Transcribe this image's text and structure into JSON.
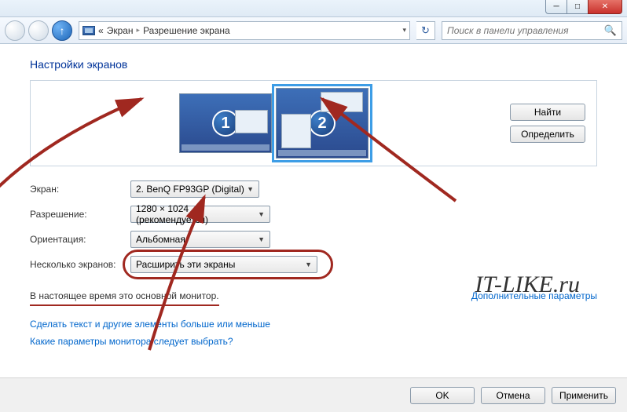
{
  "titlebar": {},
  "nav": {
    "crumb_sep1": "«",
    "crumb1": "Экран",
    "crumb_arrow": "▸",
    "crumb2": "Разрешение экрана",
    "refresh_glyph": "↻",
    "search_placeholder": "Поиск в панели управления"
  },
  "page_title": "Настройки экранов",
  "monitors": {
    "mon1_num": "1",
    "mon2_num": "2",
    "find_btn": "Найти",
    "detect_btn": "Определить"
  },
  "form": {
    "screen_label": "Экран:",
    "screen_value": "2. BenQ FP93GP (Digital)",
    "res_label": "Разрешение:",
    "res_value": "1280 × 1024 (рекомендуется)",
    "orient_label": "Ориентация:",
    "orient_value": "Альбомная",
    "multi_label": "Несколько экранов:",
    "multi_value": "Расширить эти экраны"
  },
  "status_text": "В настоящее время это основной монитор.",
  "adv_link": "Дополнительные параметры",
  "help1": "Сделать текст и другие элементы больше или меньше",
  "help2": "Какие параметры монитора следует выбрать?",
  "buttons": {
    "ok": "OK",
    "cancel": "Отмена",
    "apply": "Применить"
  },
  "watermark": "IT-LIKE.ru"
}
